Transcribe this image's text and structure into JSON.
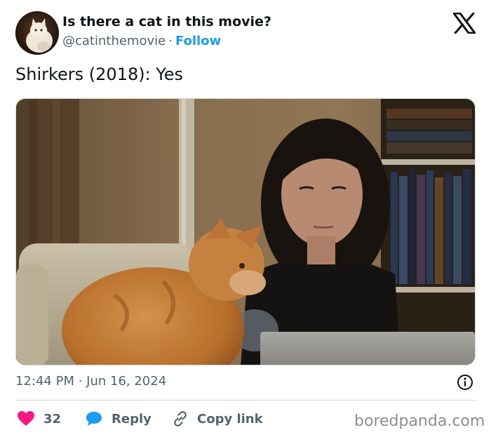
{
  "author": {
    "display_name": "Is there a cat in this movie?",
    "handle": "@catinthemovie",
    "separator": "·",
    "follow_label": "Follow"
  },
  "brand_icon": "x-logo-icon",
  "tweet": {
    "text": "Shirkers (2018): Yes",
    "timestamp": "12:44 PM · Jun 16, 2024"
  },
  "actions": {
    "likes_count": "32",
    "reply_label": "Reply",
    "copy_link_label": "Copy link"
  },
  "watermark": "boredpanda.com",
  "colors": {
    "link_blue": "#1d9bf0",
    "like_pink": "#f91880",
    "secondary_text": "#536471",
    "divider": "#cfd9de"
  }
}
